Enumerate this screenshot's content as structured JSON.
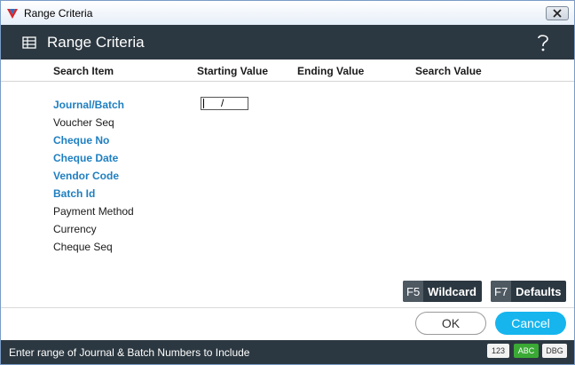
{
  "window": {
    "title": "Range Criteria"
  },
  "header": {
    "title": "Range Criteria",
    "icon": "table-grid-icon",
    "help_icon": "help-icon"
  },
  "columns": {
    "search_item": "Search Item",
    "starting_value": "Starting Value",
    "ending_value": "Ending Value",
    "search_value": "Search Value"
  },
  "items": [
    {
      "label": "Journal/Batch",
      "required": true
    },
    {
      "label": "Voucher Seq",
      "required": false
    },
    {
      "label": "Cheque No",
      "required": true
    },
    {
      "label": "Cheque Date",
      "required": true
    },
    {
      "label": "Vendor Code",
      "required": true
    },
    {
      "label": "Batch Id",
      "required": true
    },
    {
      "label": "Payment Method",
      "required": false
    },
    {
      "label": "Currency",
      "required": false
    },
    {
      "label": "Cheque Seq",
      "required": false
    }
  ],
  "journal_input": {
    "value": "/"
  },
  "function_keys": {
    "wildcard": {
      "key": "F5",
      "label": "Wildcard"
    },
    "defaults": {
      "key": "F7",
      "label": "Defaults"
    }
  },
  "buttons": {
    "ok": "OK",
    "cancel": "Cancel"
  },
  "status": {
    "message": "Enter range of Journal & Batch Numbers to Include",
    "badges": [
      "123",
      "ABC",
      "DBG"
    ]
  },
  "colors": {
    "header_bg": "#2c3841",
    "required_label": "#1f7fc0",
    "cancel_bg": "#16b5ee",
    "abc_badge": "#3aaa35"
  }
}
